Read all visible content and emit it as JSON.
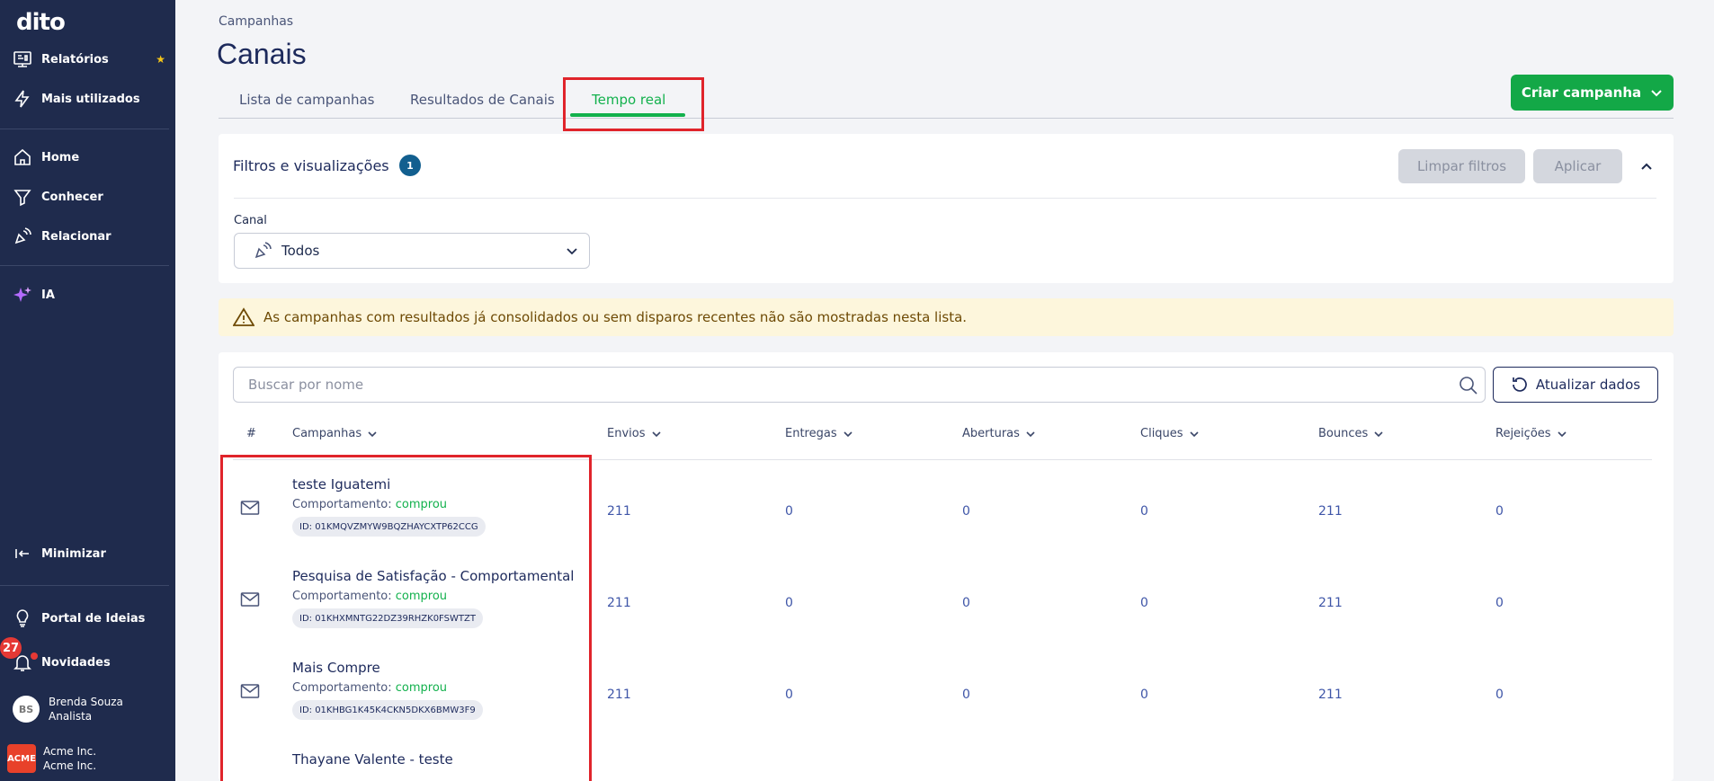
{
  "sidebar": {
    "logo": "dito",
    "items": [
      {
        "label": "Relatórios"
      },
      {
        "label": "Mais utilizados"
      },
      {
        "label": "Home"
      },
      {
        "label": "Conhecer"
      },
      {
        "label": "Relacionar"
      },
      {
        "label": "IA"
      },
      {
        "label": "Minimizar"
      },
      {
        "label": "Portal de Ideias"
      },
      {
        "label": "Novidades"
      }
    ],
    "notifications_count": "27",
    "user": {
      "initials": "BS",
      "name": "Brenda Souza",
      "role": "Analista"
    },
    "company": {
      "logo_text": "ACME",
      "name": "Acme Inc.",
      "subname": "Acme Inc."
    }
  },
  "header": {
    "breadcrumb": "Campanhas",
    "title": "Canais",
    "tabs": [
      {
        "label": "Lista de campanhas"
      },
      {
        "label": "Resultados de Canais"
      },
      {
        "label": "Tempo real",
        "active": true
      }
    ],
    "create_button": "Criar campanha"
  },
  "filters": {
    "title": "Filtros e visualizações",
    "badge": "1",
    "clear_button": "Limpar filtros",
    "apply_button": "Aplicar",
    "canal_label": "Canal",
    "canal_value": "Todos"
  },
  "alert": {
    "text": "As campanhas com resultados já consolidados ou sem disparos recentes não são mostradas nesta lista."
  },
  "search": {
    "placeholder": "Buscar por nome",
    "refresh_button": "Atualizar dados"
  },
  "table": {
    "headers": [
      "#",
      "Campanhas",
      "Envios",
      "Entregas",
      "Aberturas",
      "Cliques",
      "Bounces",
      "Rejeições"
    ],
    "rows": [
      {
        "name": "teste Iguatemi",
        "behavior_label": "Comportamento:",
        "behavior_value": "comprou",
        "id": "ID: 01KMQVZMYW9BQZHAYCXTP62CCG",
        "envios": "211",
        "entregas": "0",
        "aberturas": "0",
        "cliques": "0",
        "bounces": "211",
        "rejeicoes": "0"
      },
      {
        "name": "Pesquisa de Satisfação - Comportamental",
        "behavior_label": "Comportamento:",
        "behavior_value": "comprou",
        "id": "ID: 01KHXMNTG22DZ39RHZK0FSWTZT",
        "envios": "211",
        "entregas": "0",
        "aberturas": "0",
        "cliques": "0",
        "bounces": "211",
        "rejeicoes": "0"
      },
      {
        "name": "Mais Compre",
        "behavior_label": "Comportamento:",
        "behavior_value": "comprou",
        "id": "ID: 01KHBG1K45K4CKN5DKX6BMW3F9",
        "envios": "211",
        "entregas": "0",
        "aberturas": "0",
        "cliques": "0",
        "bounces": "211",
        "rejeicoes": "0"
      },
      {
        "name": "Thayane Valente - teste"
      }
    ]
  },
  "colors": {
    "sidebar_bg": "#1f2b4d",
    "accent_green": "#13b14d",
    "highlight_red": "#e0242b",
    "alert_bg": "#fdf6dc"
  }
}
